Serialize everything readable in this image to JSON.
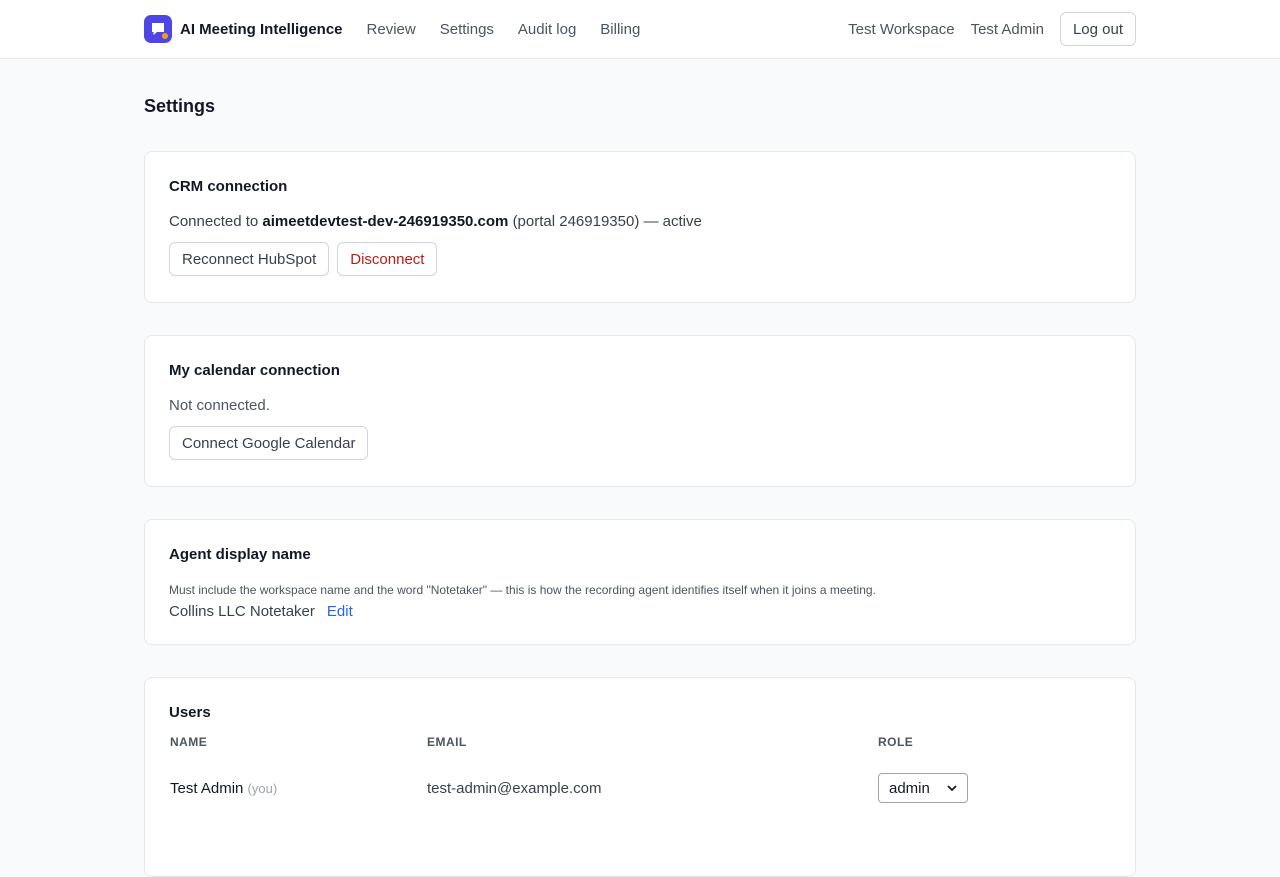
{
  "header": {
    "brand": "AI Meeting Intelligence",
    "nav": [
      "Review",
      "Settings",
      "Audit log",
      "Billing"
    ],
    "workspace": "Test Workspace",
    "user": "Test Admin",
    "logout_label": "Log out"
  },
  "page": {
    "title": "Settings"
  },
  "crm": {
    "title": "CRM connection",
    "prefix": "Connected to",
    "domain": "aimeetdevtest-dev-246919350.com",
    "suffix": "(portal 246919350) — active",
    "reconnect_label": "Reconnect HubSpot",
    "disconnect_label": "Disconnect"
  },
  "calendar": {
    "title": "My calendar connection",
    "status": "Not connected.",
    "connect_label": "Connect Google Calendar"
  },
  "agent": {
    "title": "Agent display name",
    "help": "Must include the workspace name and the word \"Notetaker\" — this is how the recording agent identifies itself when it joins a meeting.",
    "name": "Collins LLC Notetaker",
    "edit_label": "Edit"
  },
  "users": {
    "title": "Users",
    "columns": [
      "NAME",
      "EMAIL",
      "ROLE"
    ],
    "rows": [
      {
        "name": "Test Admin",
        "you": "(you)",
        "email": "test-admin@example.com",
        "role": "admin"
      }
    ]
  },
  "colors": {
    "accent": "#4f46e5",
    "danger": "#b91c1c",
    "link": "#2563eb"
  }
}
